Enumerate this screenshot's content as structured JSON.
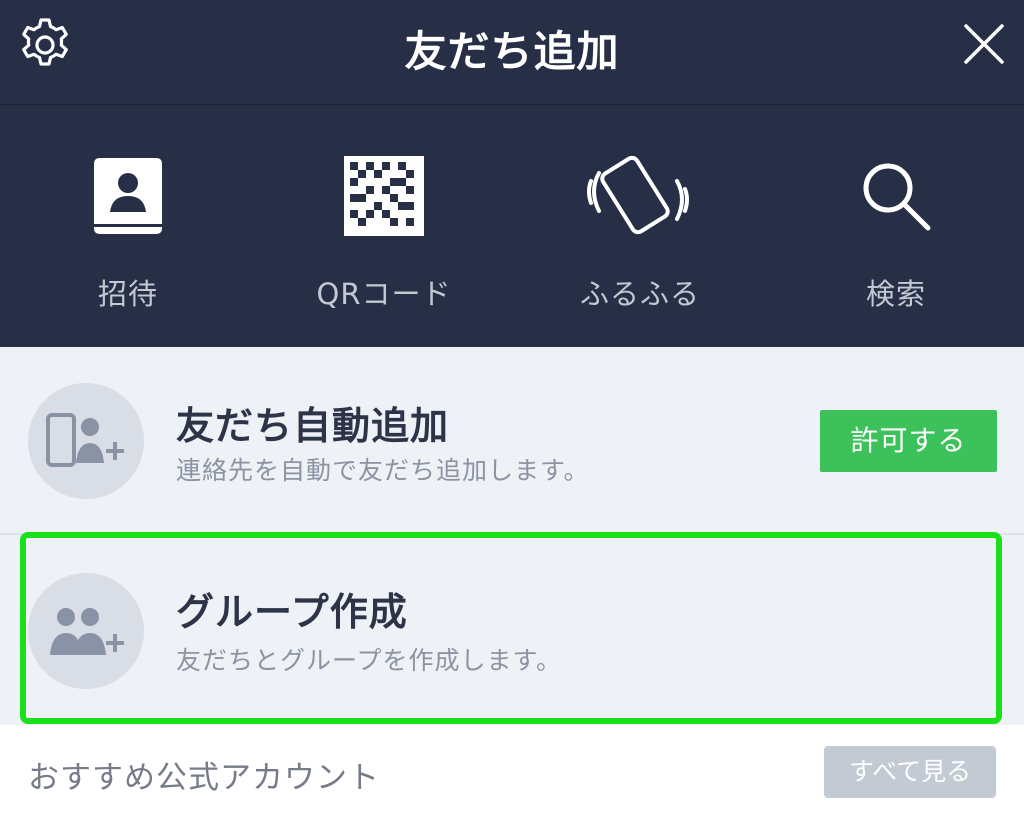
{
  "header": {
    "title": "友だち追加",
    "settings_icon": "gear-icon",
    "close_icon": "close-icon"
  },
  "actions": [
    {
      "label": "招待",
      "icon": "contact-book-icon"
    },
    {
      "label": "QRコード",
      "icon": "qr-code-icon"
    },
    {
      "label": "ふるふる",
      "icon": "shake-phone-icon"
    },
    {
      "label": "検索",
      "icon": "search-icon"
    }
  ],
  "auto_add": {
    "title": "友だち自動追加",
    "subtitle": "連絡先を自動で友だち追加します。",
    "button_label": "許可する",
    "icon": "phone-user-add-icon"
  },
  "group": {
    "title": "グループ作成",
    "subtitle": "友だちとグループを作成します。",
    "icon": "group-add-icon"
  },
  "footer": {
    "label": "おすすめ公式アカウント",
    "button_label": "すべて見る"
  },
  "colors": {
    "header_bg": "#262f45",
    "allow_button": "#3dc25b",
    "highlight": "#19e019",
    "row_bg": "#eef1f6"
  }
}
